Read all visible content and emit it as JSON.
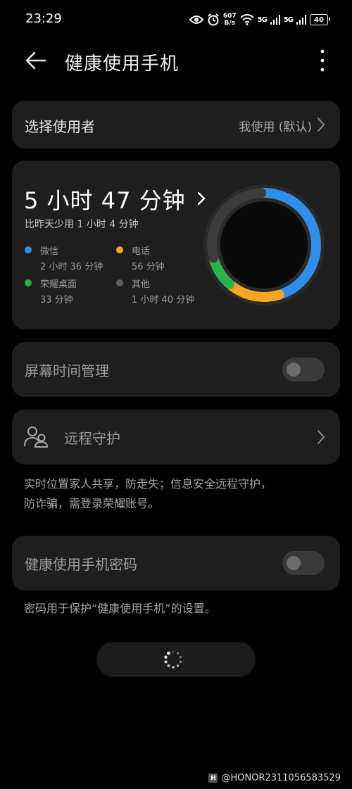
{
  "status_bar": {
    "time": "23:29",
    "net_speed_value": "607",
    "net_speed_unit": "B/s",
    "signal1_label": "5G",
    "signal2_label": "5G",
    "battery": "40"
  },
  "header": {
    "title": "健康使用手机"
  },
  "user_select": {
    "label": "选择使用者",
    "value": "我使用 (默认)"
  },
  "usage": {
    "total": "5 小时 47 分钟",
    "comparison": "比昨天少用 1 小时 4 分钟",
    "categories": [
      {
        "name": "微信",
        "duration": "2 小时 36 分钟",
        "minutes": 156,
        "color": "#2f8ee8"
      },
      {
        "name": "电话",
        "duration": "56 分钟",
        "minutes": 56,
        "color": "#f5a623"
      },
      {
        "name": "荣耀桌面",
        "duration": "33 分钟",
        "minutes": 33,
        "color": "#2bb24c"
      },
      {
        "name": "其他",
        "duration": "1 小时 40 分钟",
        "minutes": 100,
        "color": "#3c3c3c"
      }
    ]
  },
  "screen_time": {
    "label": "屏幕时间管理",
    "enabled": false
  },
  "remote_protect": {
    "label": "远程守护",
    "description_line1": "实时位置家人共享，防走失；信息安全远程守护，",
    "description_line2": "防诈骗，需登录荣耀账号。"
  },
  "password": {
    "label": "健康使用手机密码",
    "enabled": false,
    "description": "密码用于保护“健康使用手机”的设置。"
  },
  "watermark": {
    "badge": "H",
    "text": "@HONOR2311056583529"
  }
}
